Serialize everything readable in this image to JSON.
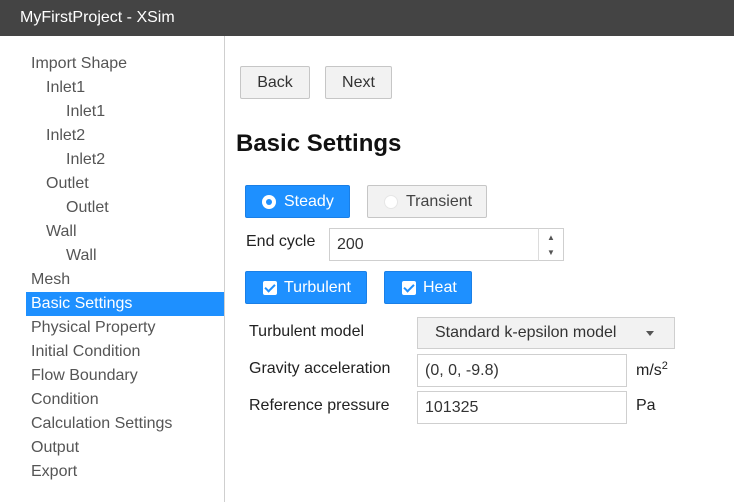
{
  "window": {
    "title": "MyFirstProject - XSim"
  },
  "sidebar": {
    "items": [
      {
        "label": "Import Shape",
        "level": 1
      },
      {
        "label": "Inlet1",
        "level": 2
      },
      {
        "label": "Inlet1",
        "level": 3
      },
      {
        "label": "Inlet2",
        "level": 2
      },
      {
        "label": "Inlet2",
        "level": 3
      },
      {
        "label": "Outlet",
        "level": 2
      },
      {
        "label": "Outlet",
        "level": 3
      },
      {
        "label": "Wall",
        "level": 2
      },
      {
        "label": "Wall",
        "level": 3
      },
      {
        "label": "Mesh",
        "level": 1
      },
      {
        "label": "Basic Settings",
        "level": 1,
        "active": true
      },
      {
        "label": "Physical Property",
        "level": 1
      },
      {
        "label": "Initial Condition",
        "level": 1
      },
      {
        "label": "Flow Boundary",
        "level": 1
      },
      {
        "label": "Condition",
        "level": 1
      },
      {
        "label": "Calculation Settings",
        "level": 1
      },
      {
        "label": "Output",
        "level": 1
      },
      {
        "label": "Export",
        "level": 1
      }
    ]
  },
  "nav": {
    "back_label": "Back",
    "next_label": "Next"
  },
  "page": {
    "title": "Basic Settings"
  },
  "mode": {
    "steady_label": "Steady",
    "transient_label": "Transient",
    "selected": "Steady"
  },
  "end_cycle": {
    "label": "End cycle",
    "value": "200"
  },
  "options": {
    "turbulent_label": "Turbulent",
    "turbulent_checked": true,
    "heat_label": "Heat",
    "heat_checked": true
  },
  "turbulent_model": {
    "label": "Turbulent model",
    "value": "Standard k-epsilon model"
  },
  "gravity": {
    "label": "Gravity acceleration",
    "value": "(0, 0, -9.8)",
    "unit": "m/s",
    "unit_exponent": "2"
  },
  "pressure": {
    "label": "Reference pressure",
    "value": "101325",
    "unit": "Pa"
  },
  "colors": {
    "accent": "#1e90ff",
    "titlebar": "#444444"
  }
}
